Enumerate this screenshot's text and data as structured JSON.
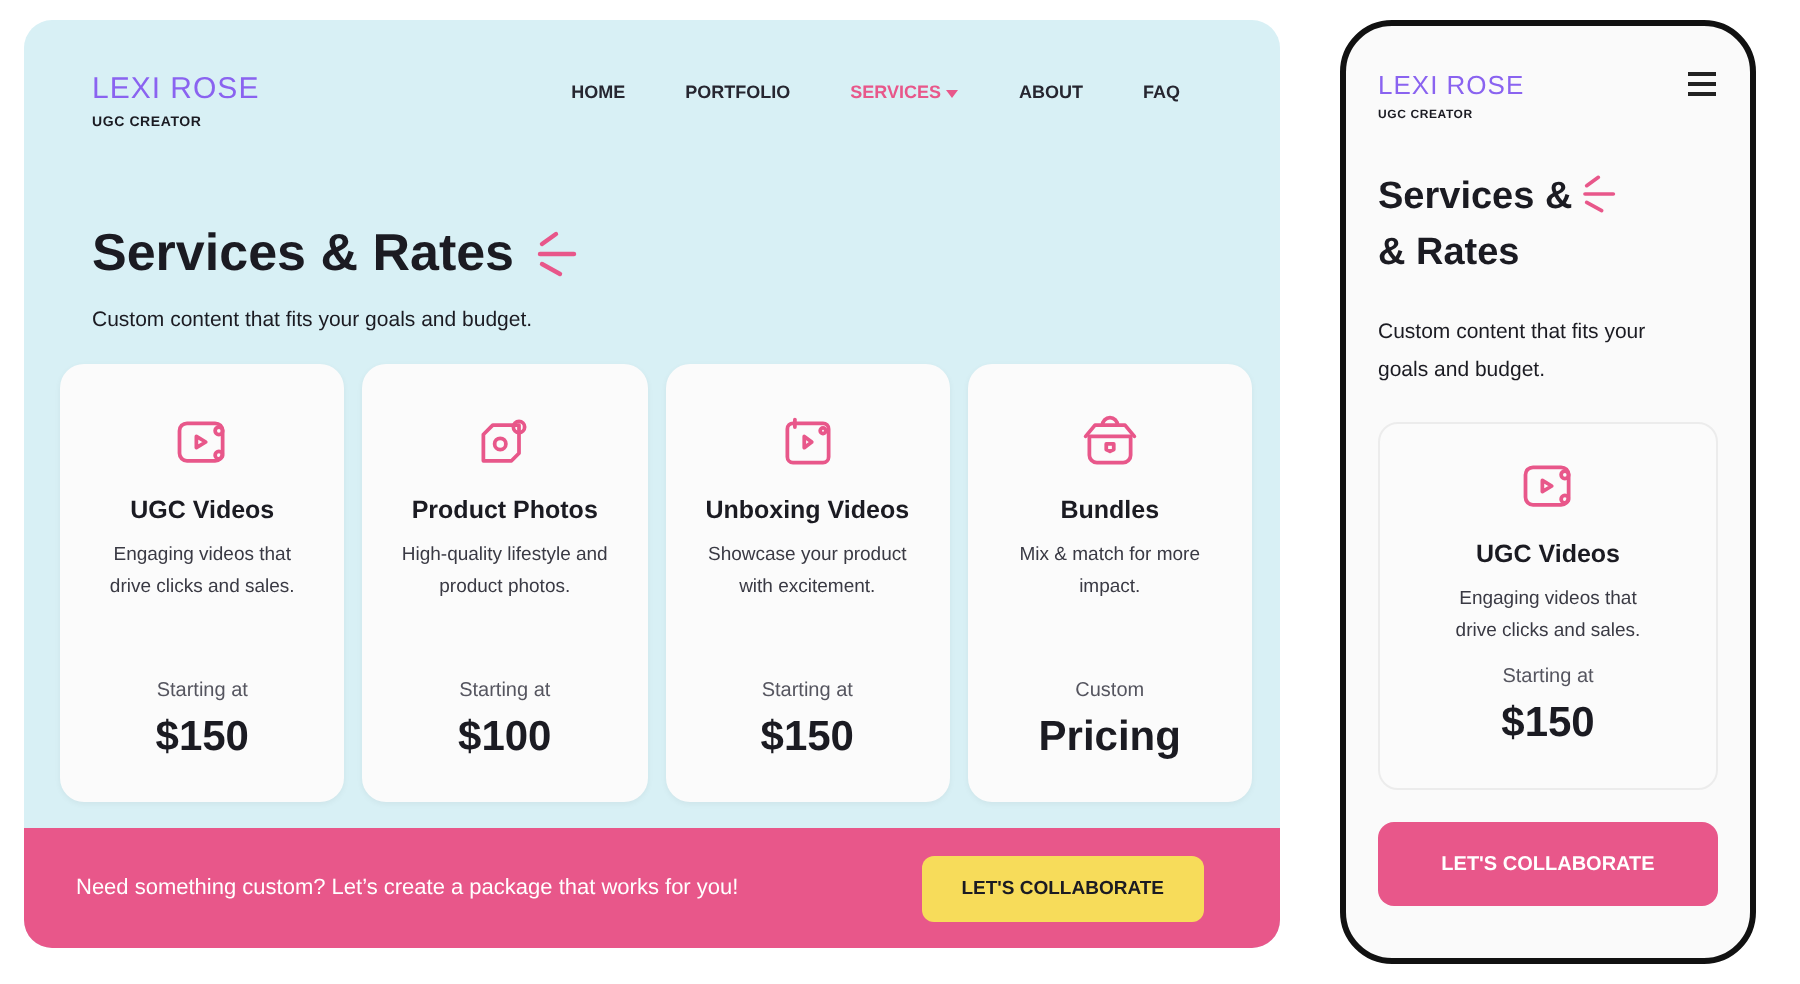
{
  "desktop": {
    "brand": {
      "name": "LEXI ROSE",
      "tagline": "UGC CREATOR"
    },
    "nav": [
      {
        "label": "HOME",
        "selected": false,
        "dropdown": false
      },
      {
        "label": "PORTFOLIO",
        "selected": false,
        "dropdown": false
      },
      {
        "label": "SERVICES",
        "selected": true,
        "dropdown": true
      },
      {
        "label": "ABOUT",
        "selected": false,
        "dropdown": false
      },
      {
        "label": "FAQ",
        "selected": false,
        "dropdown": false
      }
    ],
    "title": "Services & Rates",
    "subtitle": "Custom content that fits your goals and budget.",
    "services": [
      {
        "kind": "video",
        "name": "UGC Videos",
        "description": "Engaging videos that drive clicks and sales.",
        "price_label": "Starting at",
        "price": "$150"
      },
      {
        "kind": "photo",
        "name": "Product Photos",
        "description": "High-quality lifestyle and product photos.",
        "price_label": "Starting at",
        "price": "$100"
      },
      {
        "kind": "unboxing",
        "name": "Unboxing Videos",
        "description": "Showcase your product with excitement.",
        "price_label": "Starting at",
        "price": "$150"
      },
      {
        "kind": "bundle",
        "name": "Bundles",
        "description": "Mix & match for more impact.",
        "price_label": "Custom",
        "price": "Pricing"
      }
    ],
    "banner": {
      "text": "Need something custom? Let’s create a package that works for you!",
      "button": "LET'S COLLABORATE"
    }
  },
  "mobile": {
    "brand": {
      "name": "LEXI ROSE",
      "tagline": "UGC CREATOR"
    },
    "title_lines": [
      "Services &",
      "& Rates"
    ],
    "subtitle": "Custom content that fits your goals and budget.",
    "service": {
      "kind": "video",
      "name": "UGC Videos",
      "description": "Engaging videos that drive clicks and sales.",
      "price_label": "Starting at",
      "price": "$150"
    },
    "button": "LET'S COLLABORATE"
  }
}
